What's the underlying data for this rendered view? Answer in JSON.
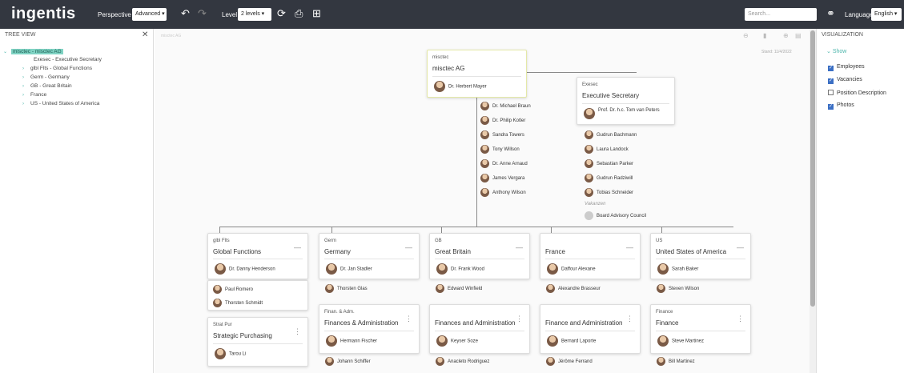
{
  "topbar": {
    "logo": "ingentis",
    "perspective_label": "Perspective",
    "perspective_value": "Advanced",
    "level_label": "Level",
    "level_value": "2 levels",
    "search_placeholder": "Search...",
    "language_label": "Language",
    "language_value": "English"
  },
  "tree": {
    "title": "Tree View",
    "items": [
      {
        "label": "misctec - misctec AG",
        "expanded": true,
        "selected": true
      },
      {
        "label": "Exesec - Executive Secretary",
        "expanded": false,
        "selected": false
      },
      {
        "label": "glbl Flts - Global Functions",
        "expanded": false,
        "selected": false
      },
      {
        "label": "Germ - Germany",
        "expanded": false,
        "selected": false
      },
      {
        "label": "GB - Great Britain",
        "expanded": false,
        "selected": false
      },
      {
        "label": "France",
        "expanded": false,
        "selected": false
      },
      {
        "label": "US - United States of America",
        "expanded": false,
        "selected": false
      }
    ]
  },
  "canvas": {
    "breadcrumb": "misctec AG",
    "date": "Stand: 11/4/2022"
  },
  "root": {
    "abbr": "misctec",
    "title": "misctec AG",
    "manager": "Dr. Herbert Mayer",
    "members": [
      "Dr. Michael Braun",
      "Dr. Philip Kotler",
      "Sandra Towers",
      "Tony Willson",
      "Dr. Anne Arnaud",
      "James Vergara",
      "Anthony Wilson"
    ]
  },
  "exec": {
    "abbr": "Exesec",
    "title": "Executive Secretary",
    "manager": "Prof. Dr. h.c. Tom van Peters",
    "members": [
      "Gudrun Bachmann",
      "Laura Landock",
      "Sebastian Parker",
      "Gudrun Radziwill",
      "Tobias Schneider"
    ],
    "vacancies_label": "Vakanzen",
    "vacancy": "Board Advisory Council"
  },
  "departments": [
    {
      "abbr": "glbl Flts",
      "title": "Global Functions",
      "manager": "Dr. Danny Henderson",
      "members": [
        "Paul Romero",
        "Thorsten Schmidt"
      ]
    },
    {
      "abbr": "Germ",
      "title": "Germany",
      "manager": "Dr. Jan Stadler",
      "members": [
        "Thorsten Glas"
      ]
    },
    {
      "abbr": "GB",
      "title": "Great Britain",
      "manager": "Dr. Frank Wood",
      "members": [
        "Edward Winfield"
      ]
    },
    {
      "abbr": "",
      "title": "France",
      "manager": "Daffour Alexane",
      "members": [
        "Alexandre Brasseur"
      ]
    },
    {
      "abbr": "US",
      "title": "United States of America",
      "manager": "Sarah Baker",
      "members": [
        "Steven Wilson"
      ]
    }
  ],
  "subunits": [
    {
      "abbr": "Strat Pur",
      "title": "Strategic Purchasing",
      "manager": "Tarou Li"
    },
    {
      "abbr": "Finan. & Adm.",
      "title": "Finances & Administration",
      "manager": "Hermann Fischer",
      "extra": "Johann Schiffer"
    },
    {
      "abbr": "",
      "title": "Finances and Administration",
      "manager": "Keyser Soze",
      "extra": "Anacleto Rodriguez"
    },
    {
      "abbr": "",
      "title": "Finance and Administration",
      "manager": "Bernard Laporte",
      "extra": "Jérôme Ferrand"
    },
    {
      "abbr": "Finance",
      "title": "Finance",
      "manager": "Steve Martinez",
      "extra": "Bill Martinez"
    }
  ],
  "visualization": {
    "title": "Visualization",
    "show_label": "Show",
    "options": [
      {
        "label": "Employees",
        "checked": true
      },
      {
        "label": "Vacancies",
        "checked": true
      },
      {
        "label": "Position Description",
        "checked": false
      },
      {
        "label": "Photos",
        "checked": true
      }
    ]
  },
  "colors": {
    "topbar": "#333740",
    "accent": "#4db6ac",
    "checkbox": "#3b6fc4"
  }
}
